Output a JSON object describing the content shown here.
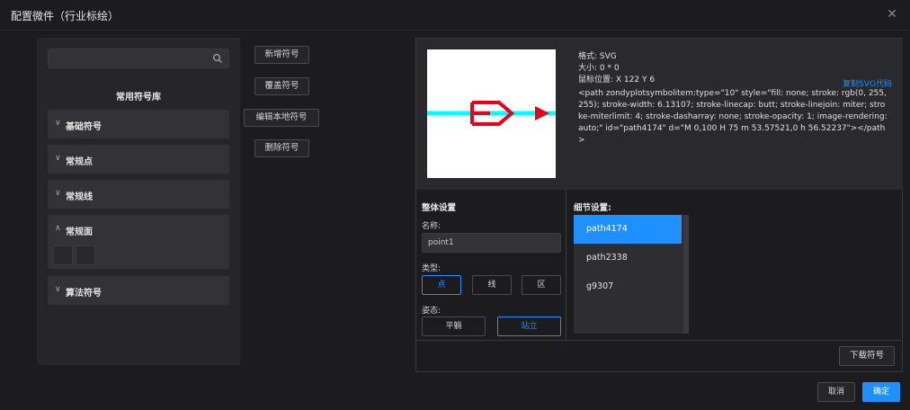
{
  "dialog": {
    "title": "配置微件（行业标绘）"
  },
  "library": {
    "search": {
      "value": "",
      "placeholder": ""
    },
    "title": "常用符号库",
    "groups": [
      {
        "label": "基础符号",
        "expanded": false
      },
      {
        "label": "常规点",
        "expanded": false
      },
      {
        "label": "常规线",
        "expanded": false
      },
      {
        "label": "常规面",
        "expanded": true
      },
      {
        "label": "算法符号",
        "expanded": false
      }
    ]
  },
  "actions": {
    "add": "新增符号",
    "overwrite": "覆盖符号",
    "edit_local": "编辑本地符号",
    "delete": "删除符号"
  },
  "preview": {
    "format": "格式: SVG",
    "size": "大小: 0 * 0",
    "mouse": "鼠标位置: X 122 Y 6",
    "copy_label": "复制SVG代码",
    "code": "<path zondyplotsymbolitem:type=\"10\" style=\"fill: none; stroke: rgb(0, 255, 255); stroke-width: 6.13107; stroke-linecap: butt; stroke-linejoin: miter; stroke-miterlimit: 4; stroke-dasharray: none; stroke-opacity: 1; image-rendering: auto;\" id=\"path4174\" d=\"M 0,100 H 75 m 53.57521,0 h 56.52237\"></path>"
  },
  "overall": {
    "title": "整体设置",
    "name_label": "名称:",
    "name_value": "point1",
    "type_label": "类型:",
    "types": [
      "点",
      "线",
      "区"
    ],
    "type_selected": "点",
    "pose_label": "姿态:",
    "poses": [
      "平躺",
      "站立"
    ],
    "pose_selected": "站立"
  },
  "details": {
    "title": "细节设置:",
    "items": [
      "path4174",
      "path2338",
      "g9307"
    ],
    "selected": "path4174"
  },
  "download_label": "下载符号",
  "footer": {
    "cancel": "取消",
    "ok": "确定"
  },
  "colors": {
    "accent": "#1e90ff",
    "symbol_red": "#e8001c",
    "symbol_cyan": "#00ffff"
  }
}
